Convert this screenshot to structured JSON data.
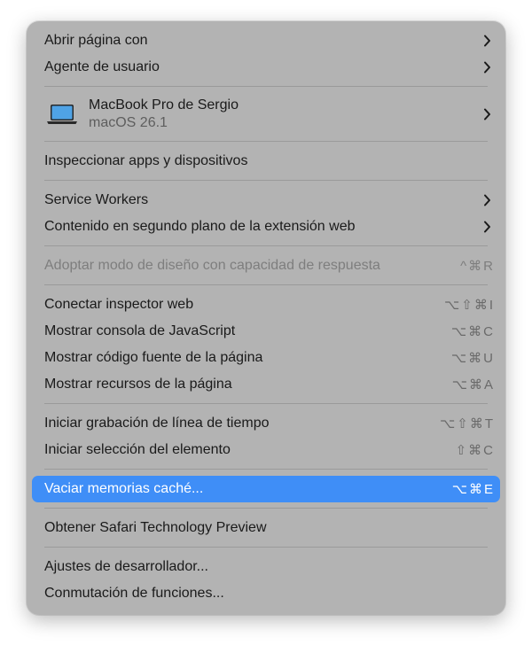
{
  "menu": {
    "group1": [
      {
        "label": "Abrir página con"
      },
      {
        "label": "Agente de usuario"
      }
    ],
    "device": {
      "name": "MacBook Pro de Sergio",
      "os": "macOS 26.1",
      "icon": "laptop-icon"
    },
    "inspect_apps": {
      "label": "Inspeccionar apps y dispositivos"
    },
    "group3": [
      {
        "label": "Service Workers"
      },
      {
        "label": "Contenido en segundo plano de la extensión web"
      }
    ],
    "responsive": {
      "label": "Adoptar modo de diseño con capacidad de respuesta",
      "shortcut": "^⌘R"
    },
    "group5": [
      {
        "label": "Conectar inspector web",
        "shortcut": "⌥⇧⌘I"
      },
      {
        "label": "Mostrar consola de JavaScript",
        "shortcut": "⌥⌘C"
      },
      {
        "label": "Mostrar código fuente de la página",
        "shortcut": "⌥⌘U"
      },
      {
        "label": "Mostrar recursos de la página",
        "shortcut": "⌥⌘A"
      }
    ],
    "group6": [
      {
        "label": "Iniciar grabación de línea de tiempo",
        "shortcut": "⌥⇧⌘T"
      },
      {
        "label": "Iniciar selección del elemento",
        "shortcut": "⇧⌘C"
      }
    ],
    "empty_caches": {
      "label": "Vaciar memorias caché...",
      "shortcut": "⌥⌘E"
    },
    "tech_preview": {
      "label": "Obtener Safari Technology Preview"
    },
    "group9": [
      {
        "label": "Ajustes de desarrollador..."
      },
      {
        "label": "Conmutación de funciones..."
      }
    ]
  },
  "colors": {
    "menu_bg": "#b3b3b3",
    "highlight": "#3f8ef7",
    "text": "#1a1a1a",
    "disabled": "#7e7e7e"
  }
}
